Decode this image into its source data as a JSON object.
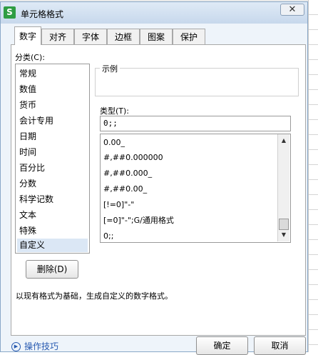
{
  "window": {
    "title": "单元格格式",
    "app_icon_letter": "S",
    "close_glyph": "✕"
  },
  "tabs": [
    {
      "label": "数字",
      "active": true
    },
    {
      "label": "对齐",
      "active": false
    },
    {
      "label": "字体",
      "active": false
    },
    {
      "label": "边框",
      "active": false
    },
    {
      "label": "图案",
      "active": false
    },
    {
      "label": "保护",
      "active": false
    }
  ],
  "category": {
    "label": "分类(C):",
    "items": [
      "常规",
      "数值",
      "货币",
      "会计专用",
      "日期",
      "时间",
      "百分比",
      "分数",
      "科学记数",
      "文本",
      "特殊",
      "自定义"
    ],
    "selected": "自定义"
  },
  "sample": {
    "label": "示例"
  },
  "type_field": {
    "label": "类型(T):",
    "value": "0;;",
    "options": [
      "0.00_",
      "#,##0.000000",
      "#,##0.000_",
      "#,##0.00_",
      "[!=0]\"-\"",
      "[=0]\"-\";G/通用格式",
      "0;;"
    ]
  },
  "delete_button": "删除(D)",
  "description": "以现有格式为基础，生成自定义的数字格式。",
  "tips_link": "操作技巧",
  "ok_button": "确定",
  "cancel_button": "取消"
}
